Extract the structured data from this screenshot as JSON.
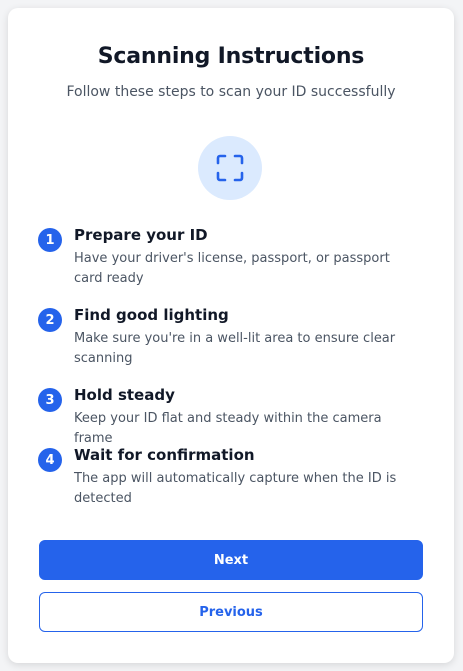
{
  "header": {
    "title": "Scanning Instructions",
    "subtitle": "Follow these steps to scan your ID successfully"
  },
  "icon": {
    "name": "scan-frame-icon",
    "background": "#dbeafe",
    "color": "#2563eb"
  },
  "steps": [
    {
      "number": "1",
      "title": "Prepare your ID",
      "description": "Have your driver's license, passport, or passport card ready"
    },
    {
      "number": "2",
      "title": "Find good lighting",
      "description": "Make sure you're in a well-lit area to ensure clear scanning"
    },
    {
      "number": "3",
      "title": "Hold steady",
      "description": "Keep your ID flat and steady within the camera frame"
    },
    {
      "number": "4",
      "title": "Wait for confirmation",
      "description": "The app will automatically capture when the ID is detected"
    }
  ],
  "buttons": {
    "next_label": "Next",
    "previous_label": "Previous"
  },
  "colors": {
    "accent": "#2563eb",
    "title": "#111827",
    "text_muted": "#4b5563"
  }
}
